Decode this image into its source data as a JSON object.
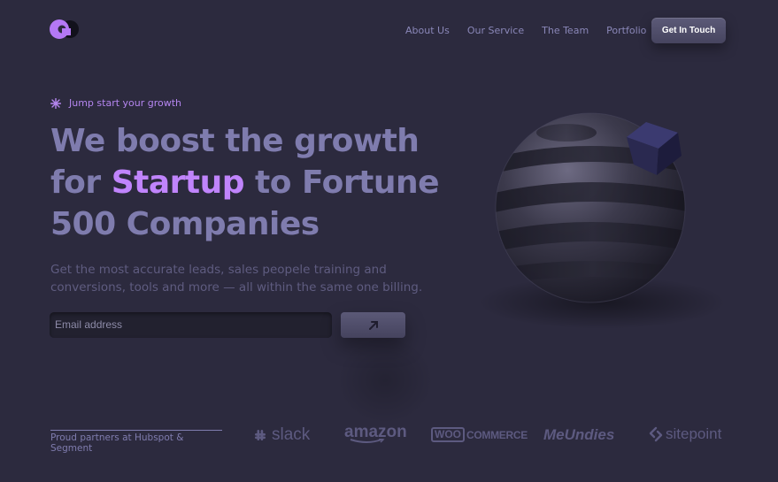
{
  "header": {
    "logo_name": "brand-logo",
    "nav": [
      {
        "label": "About Us"
      },
      {
        "label": "Our Service"
      },
      {
        "label": "The Team"
      },
      {
        "label": "Portfolio"
      }
    ],
    "cta_label": "Get In Touch"
  },
  "hero": {
    "eyebrow": "Jump start your growth",
    "headline_line1": "We boost the growth",
    "headline_for": "for ",
    "headline_accent": "Startup",
    "headline_after_accent": " to Fortune",
    "headline_line3": "500 Companies",
    "subtext": "Get the most accurate leads, sales peopele training and conversions, tools and more — all within the same one billing.",
    "email_placeholder": "Email address"
  },
  "partners": {
    "label": "Proud partners at Hubspot & Segment",
    "brands": {
      "slack": "slack",
      "amazon": "amazon",
      "woo_box": "WOO",
      "woo_text": "COMMERCE",
      "meundies": "MeUndies",
      "sitepoint": "sitepoint"
    }
  },
  "colors": {
    "background": "#2c2a3e",
    "accent": "#c084fc",
    "headline": "#7f7cae",
    "muted": "#5f5c80"
  }
}
